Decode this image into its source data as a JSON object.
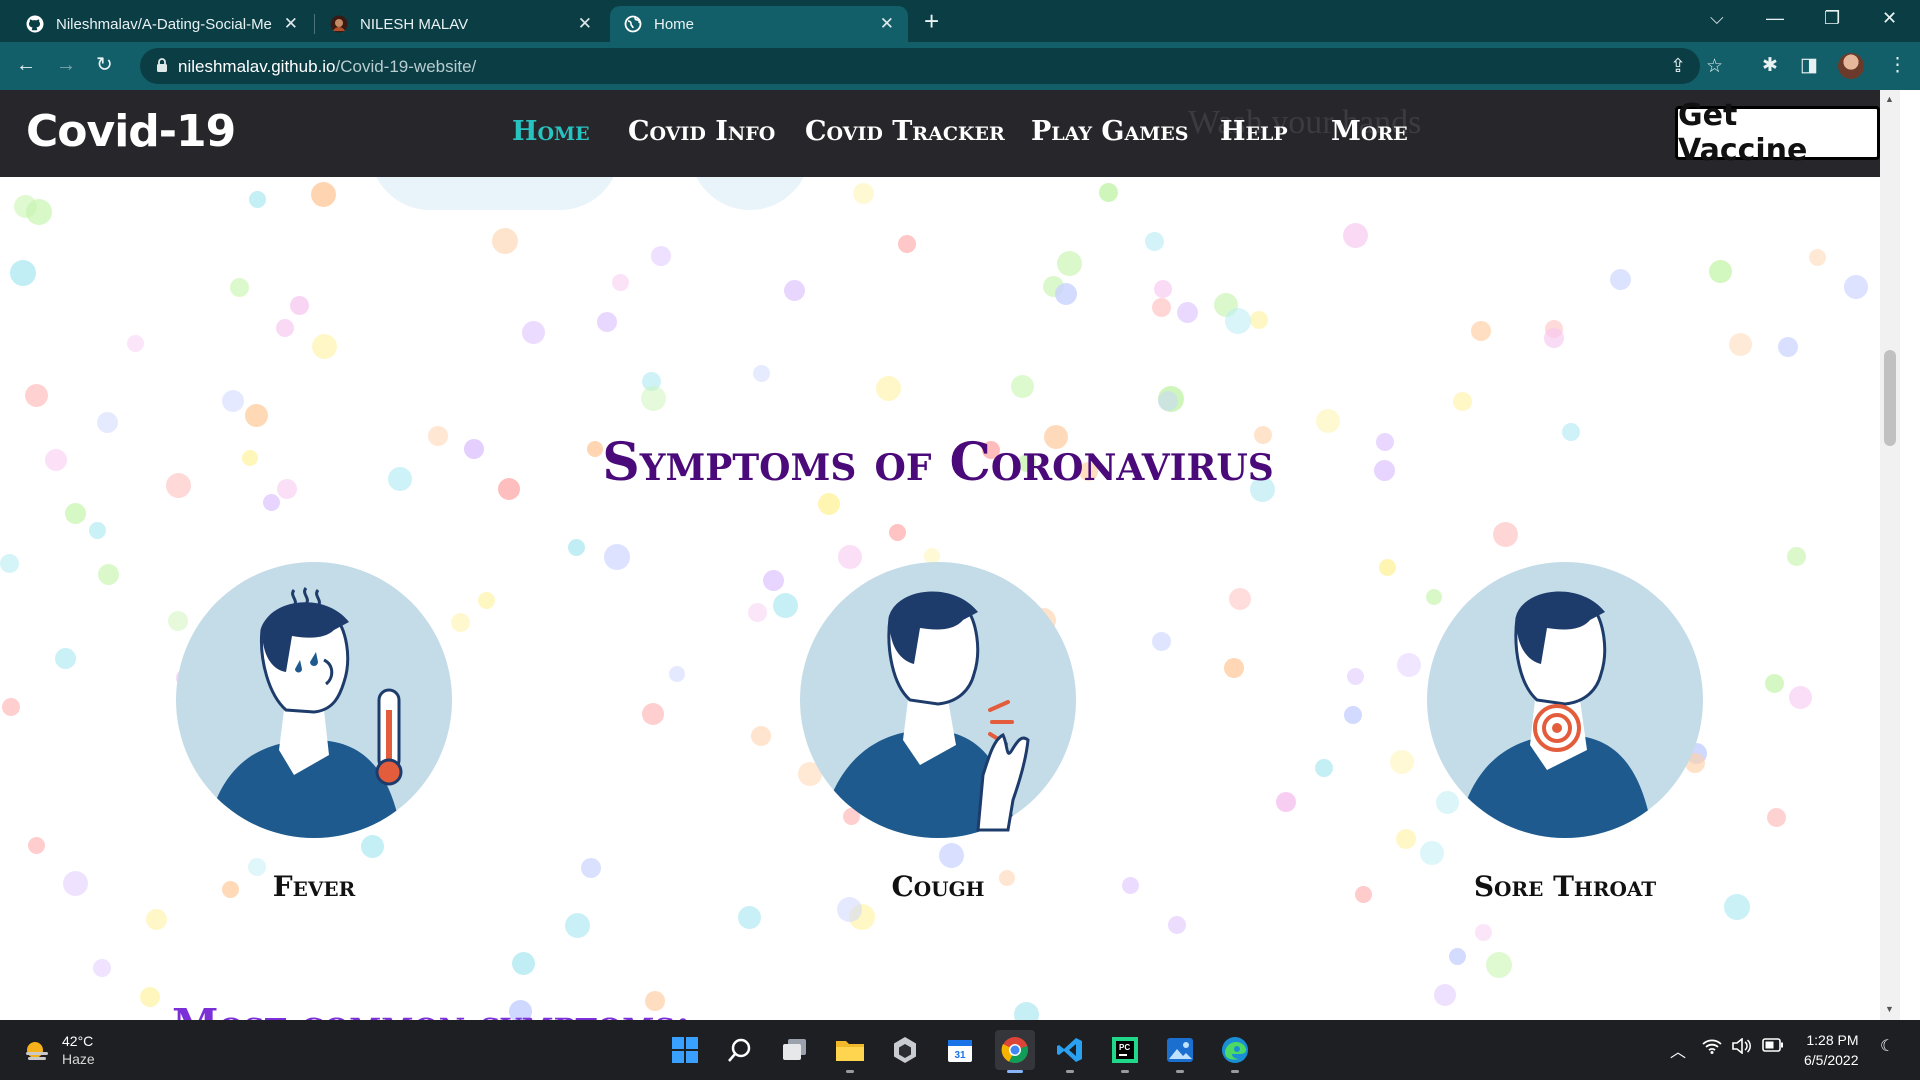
{
  "browser": {
    "tabs": [
      {
        "title": "Nileshmalav/A-Dating-Social-Me",
        "favicon": "github-icon",
        "active": false
      },
      {
        "title": "NILESH MALAV",
        "favicon": "avatar-favicon",
        "active": false
      },
      {
        "title": "Home",
        "favicon": "globe-icon",
        "active": true
      }
    ],
    "url_host": "nileshmalav.github.io",
    "url_path": "/Covid-19-website/",
    "colors": {
      "frame": "#0b3d45",
      "toolbar": "#135f69"
    }
  },
  "site": {
    "brand": "Covid-19",
    "nav": [
      {
        "label": "Home",
        "current": true
      },
      {
        "label": "Covid Info",
        "current": false
      },
      {
        "label": "Covid Tracker",
        "current": false
      },
      {
        "label": "Play Games",
        "current": false
      },
      {
        "label": "Help",
        "current": false
      },
      {
        "label": "More",
        "current": false
      }
    ],
    "cta": "Get Vaccine",
    "behind_text": "Wash your hands",
    "colors": {
      "nav_bg": "#27272b",
      "nav_current": "#26c3c0",
      "heading": "#4a0a7a",
      "next_heading": "#7b2fd6"
    }
  },
  "symptoms": {
    "heading": "Symptoms of Coronavirus",
    "items": [
      {
        "label": "Fever",
        "icon": "fever-illustration-icon"
      },
      {
        "label": "Cough",
        "icon": "cough-illustration-icon"
      },
      {
        "label": "Sore Throat",
        "icon": "sore-throat-illustration-icon"
      }
    ],
    "next_heading": "Most common symptoms:"
  },
  "taskbar": {
    "weather_temp": "42°C",
    "weather_cond": "Haze",
    "apps": [
      "windows-start-icon",
      "search-icon",
      "task-view-icon",
      "file-explorer-icon",
      "unity-icon",
      "calendar-icon",
      "chrome-icon",
      "vscode-icon",
      "pycharm-icon",
      "photos-icon",
      "edge-icon"
    ],
    "time": "1:28 PM",
    "date": "6/5/2022"
  }
}
